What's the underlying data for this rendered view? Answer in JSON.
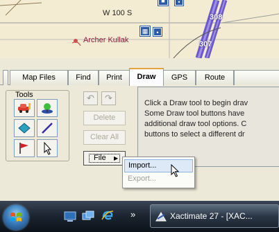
{
  "map": {
    "road_label": "W 100 S",
    "place_label": "Archer Kullak",
    "route_numbers": [
      "308",
      "307"
    ]
  },
  "tabs": [
    {
      "label": "Map Files"
    },
    {
      "label": "Find"
    },
    {
      "label": "Print"
    },
    {
      "label": "Draw"
    },
    {
      "label": "GPS"
    },
    {
      "label": "Route"
    }
  ],
  "active_tab": "Draw",
  "tools": {
    "group_label": "Tools",
    "icons": [
      "car-tool-icon",
      "pin-tool-icon",
      "polygon-tool-icon",
      "line-tool-icon",
      "flag-tool-icon",
      "select-tool-icon"
    ]
  },
  "side_buttons": {
    "undo_icon": "undo-icon",
    "redo_icon": "redo-icon",
    "delete_label": "Delete",
    "clear_all_label": "Clear All",
    "file_label": "File"
  },
  "info": {
    "lines": [
      "Click a Draw tool to begin drav",
      "Some Draw tool buttons have",
      "additional draw tool options. C",
      "buttons to select a different dr"
    ]
  },
  "file_menu": {
    "items": [
      {
        "label": "Import...",
        "enabled": true,
        "highlighted": true
      },
      {
        "label": "Export...",
        "enabled": false,
        "highlighted": false
      }
    ]
  },
  "taskbar": {
    "more_label": "»",
    "task_label": "Xactimate 27 - [XAC..."
  }
}
